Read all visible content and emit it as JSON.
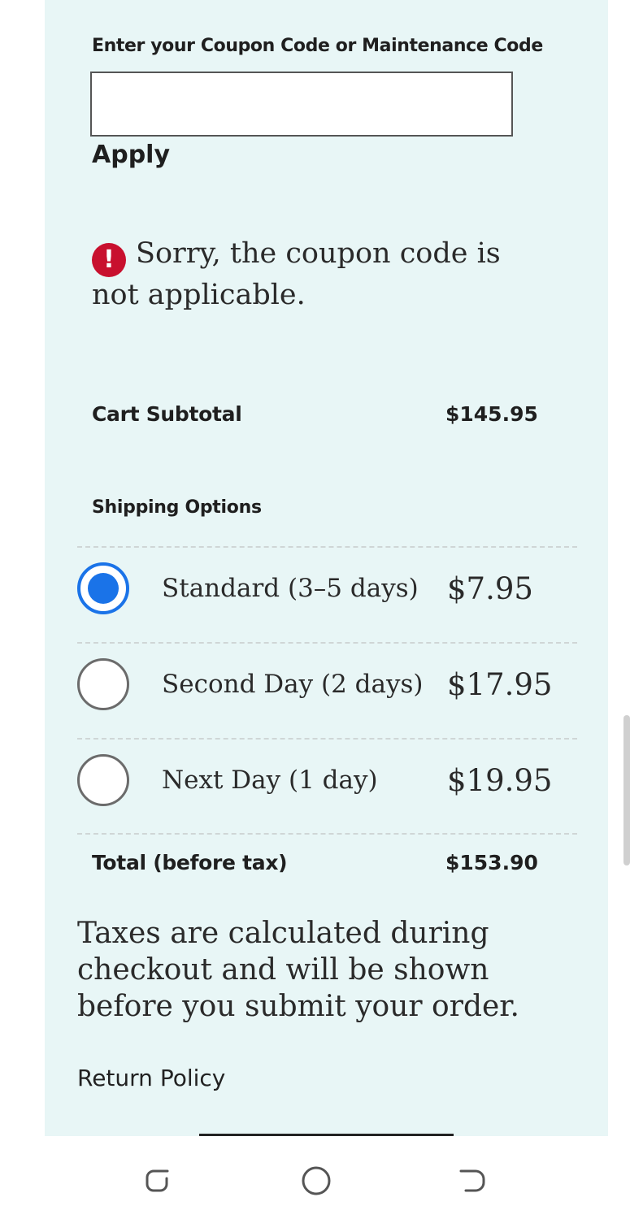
{
  "coupon": {
    "label": "Enter your Coupon Code or Maintenance Code",
    "value": "",
    "placeholder": "",
    "apply_label": "Apply",
    "error_icon": "!",
    "error_message": "Sorry, the coupon code is not applicable."
  },
  "summary": {
    "subtotal_label": "Cart Subtotal",
    "subtotal_value": "$145.95",
    "total_label": "Total (before tax)",
    "total_value": "$153.90"
  },
  "shipping": {
    "heading": "Shipping Options",
    "selected_index": 0,
    "options": [
      {
        "name": "Standard (3–5 days)",
        "price": "$7.95",
        "selected": true
      },
      {
        "name": "Second Day (2 days)",
        "price": "$17.95",
        "selected": false
      },
      {
        "name": "Next Day (1 day)",
        "price": "$19.95",
        "selected": false
      }
    ]
  },
  "tax_note": "Taxes are calculated during checkout and will be shown before you submit your order.",
  "links": {
    "return_policy": "Return Policy"
  },
  "colors": {
    "panel_background": "#e8f6f6",
    "radio_selected": "#1a73e8",
    "error_icon": "#c8102e"
  },
  "system_nav": {
    "buttons": [
      "recents-icon",
      "home-icon",
      "back-icon"
    ]
  }
}
